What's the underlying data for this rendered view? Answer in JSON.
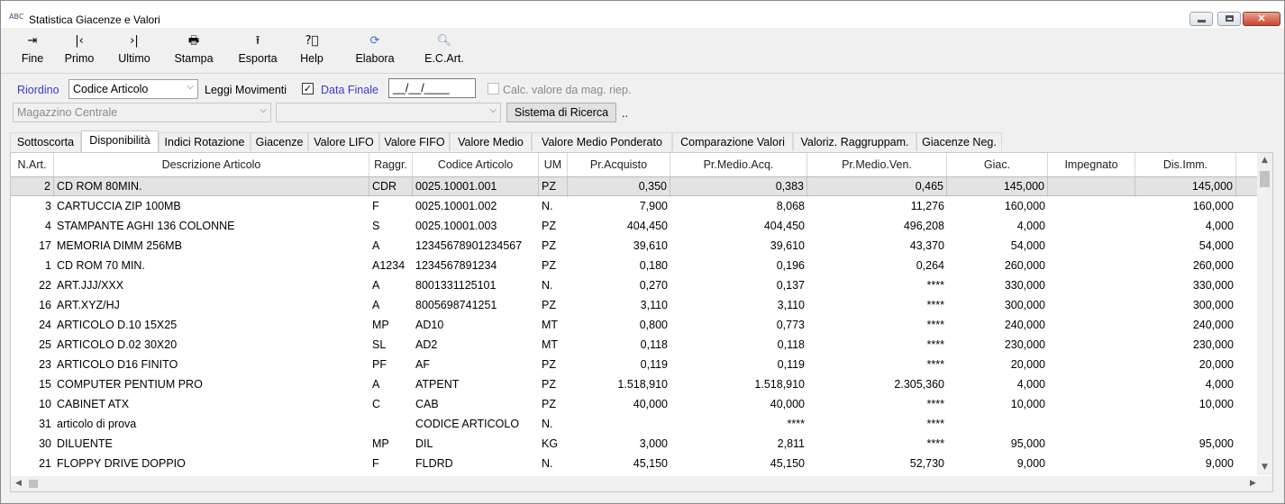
{
  "window": {
    "title": "Statistica Giacenze e Valori",
    "app_icon": "ABC"
  },
  "toolbar": {
    "fine": "Fine",
    "primo": "Primo",
    "ultimo": "Ultimo",
    "stampa": "Stampa",
    "esporta": "Esporta",
    "help": "Help",
    "elabora": "Elabora",
    "ecart": "E.C.Art."
  },
  "options": {
    "riordino_label": "Riordino",
    "riordino_value": "Codice Articolo",
    "leggi_movimenti_label": "Leggi Movimenti",
    "leggi_movimenti_checked": true,
    "data_finale_label": "Data Finale",
    "data_finale_value": "__/__/____",
    "calc_valore_label": "Calc. valore da mag. riep.",
    "magazzino_value": "Magazzino Centrale",
    "second_combo_value": "",
    "sistema_ricerca_label": "Sistema di Ricerca",
    "extra_label": ".."
  },
  "tabs": [
    "Sottoscorta",
    "Disponibilità",
    "Indici Rotazione",
    "Giacenze",
    "Valore LIFO",
    "Valore FIFO",
    "Valore Medio",
    "Valore Medio Ponderato",
    "Comparazione Valori",
    "Valoriz. Raggruppam.",
    "Giacenze Neg."
  ],
  "active_tab": "Disponibilità",
  "table": {
    "columns": [
      "N.Art.",
      "Descrizione Articolo",
      "Raggr.",
      "Codice Articolo",
      "UM",
      "Pr.Acquisto",
      "Pr.Medio.Acq.",
      "Pr.Medio.Ven.",
      "Giac.",
      "Impegnato",
      "Dis.Imm."
    ],
    "rows": [
      [
        "2",
        "CD ROM 80MIN.",
        "CDR",
        "0025.10001.001",
        "PZ",
        "0,350",
        "0,383",
        "0,465",
        "145,000",
        "",
        "145,000"
      ],
      [
        "3",
        "CARTUCCIA ZIP 100MB",
        "F",
        "0025.10001.002",
        "N.",
        "7,900",
        "8,068",
        "11,276",
        "160,000",
        "",
        "160,000"
      ],
      [
        "4",
        "STAMPANTE AGHI 136 COLONNE",
        "S",
        "0025.10001.003",
        "PZ",
        "404,450",
        "404,450",
        "496,208",
        "4,000",
        "",
        "4,000"
      ],
      [
        "17",
        "MEMORIA DIMM 256MB",
        "A",
        "12345678901234567",
        "PZ",
        "39,610",
        "39,610",
        "43,370",
        "54,000",
        "",
        "54,000"
      ],
      [
        "1",
        "CD ROM 70 MIN.",
        "A1234",
        "1234567891234",
        "PZ",
        "0,180",
        "0,196",
        "0,264",
        "260,000",
        "",
        "260,000"
      ],
      [
        "22",
        "ART.JJJ/XXX",
        "A",
        "8001331125101",
        "N.",
        "0,270",
        "0,137",
        "****",
        "330,000",
        "",
        "330,000"
      ],
      [
        "16",
        "ART.XYZ/HJ",
        "A",
        "8005698741251",
        "PZ",
        "3,110",
        "3,110",
        "****",
        "300,000",
        "",
        "300,000"
      ],
      [
        "24",
        "ARTICOLO D.10  15X25",
        "MP",
        "AD10",
        "MT",
        "0,800",
        "0,773",
        "****",
        "240,000",
        "",
        "240,000"
      ],
      [
        "25",
        "ARTICOLO D.02  30X20",
        "SL",
        "AD2",
        "MT",
        "0,118",
        "0,118",
        "****",
        "230,000",
        "",
        "230,000"
      ],
      [
        "23",
        "ARTICOLO D16 FINITO",
        "PF",
        "AF",
        "PZ",
        "0,119",
        "0,119",
        "****",
        "20,000",
        "",
        "20,000"
      ],
      [
        "15",
        "COMPUTER PENTIUM PRO",
        "A",
        "ATPENT",
        "PZ",
        "1.518,910",
        "1.518,910",
        "2.305,360",
        "4,000",
        "",
        "4,000"
      ],
      [
        "10",
        "CABINET ATX",
        "C",
        "CAB",
        "PZ",
        "40,000",
        "40,000",
        "****",
        "10,000",
        "",
        "10,000"
      ],
      [
        "31",
        "articolo di prova",
        "",
        "CODICE ARTICOLO",
        "N.",
        "",
        "****",
        "****",
        "",
        "",
        ""
      ],
      [
        "30",
        "DILUENTE",
        "MP",
        "DIL",
        "KG",
        "3,000",
        "2,811",
        "****",
        "95,000",
        "",
        "95,000"
      ],
      [
        "21",
        "FLOPPY DRIVE DOPPIO",
        "F",
        "FLDRD",
        "N.",
        "45,150",
        "45,150",
        "52,730",
        "9,000",
        "",
        "9,000"
      ]
    ],
    "selected_row": 0
  }
}
